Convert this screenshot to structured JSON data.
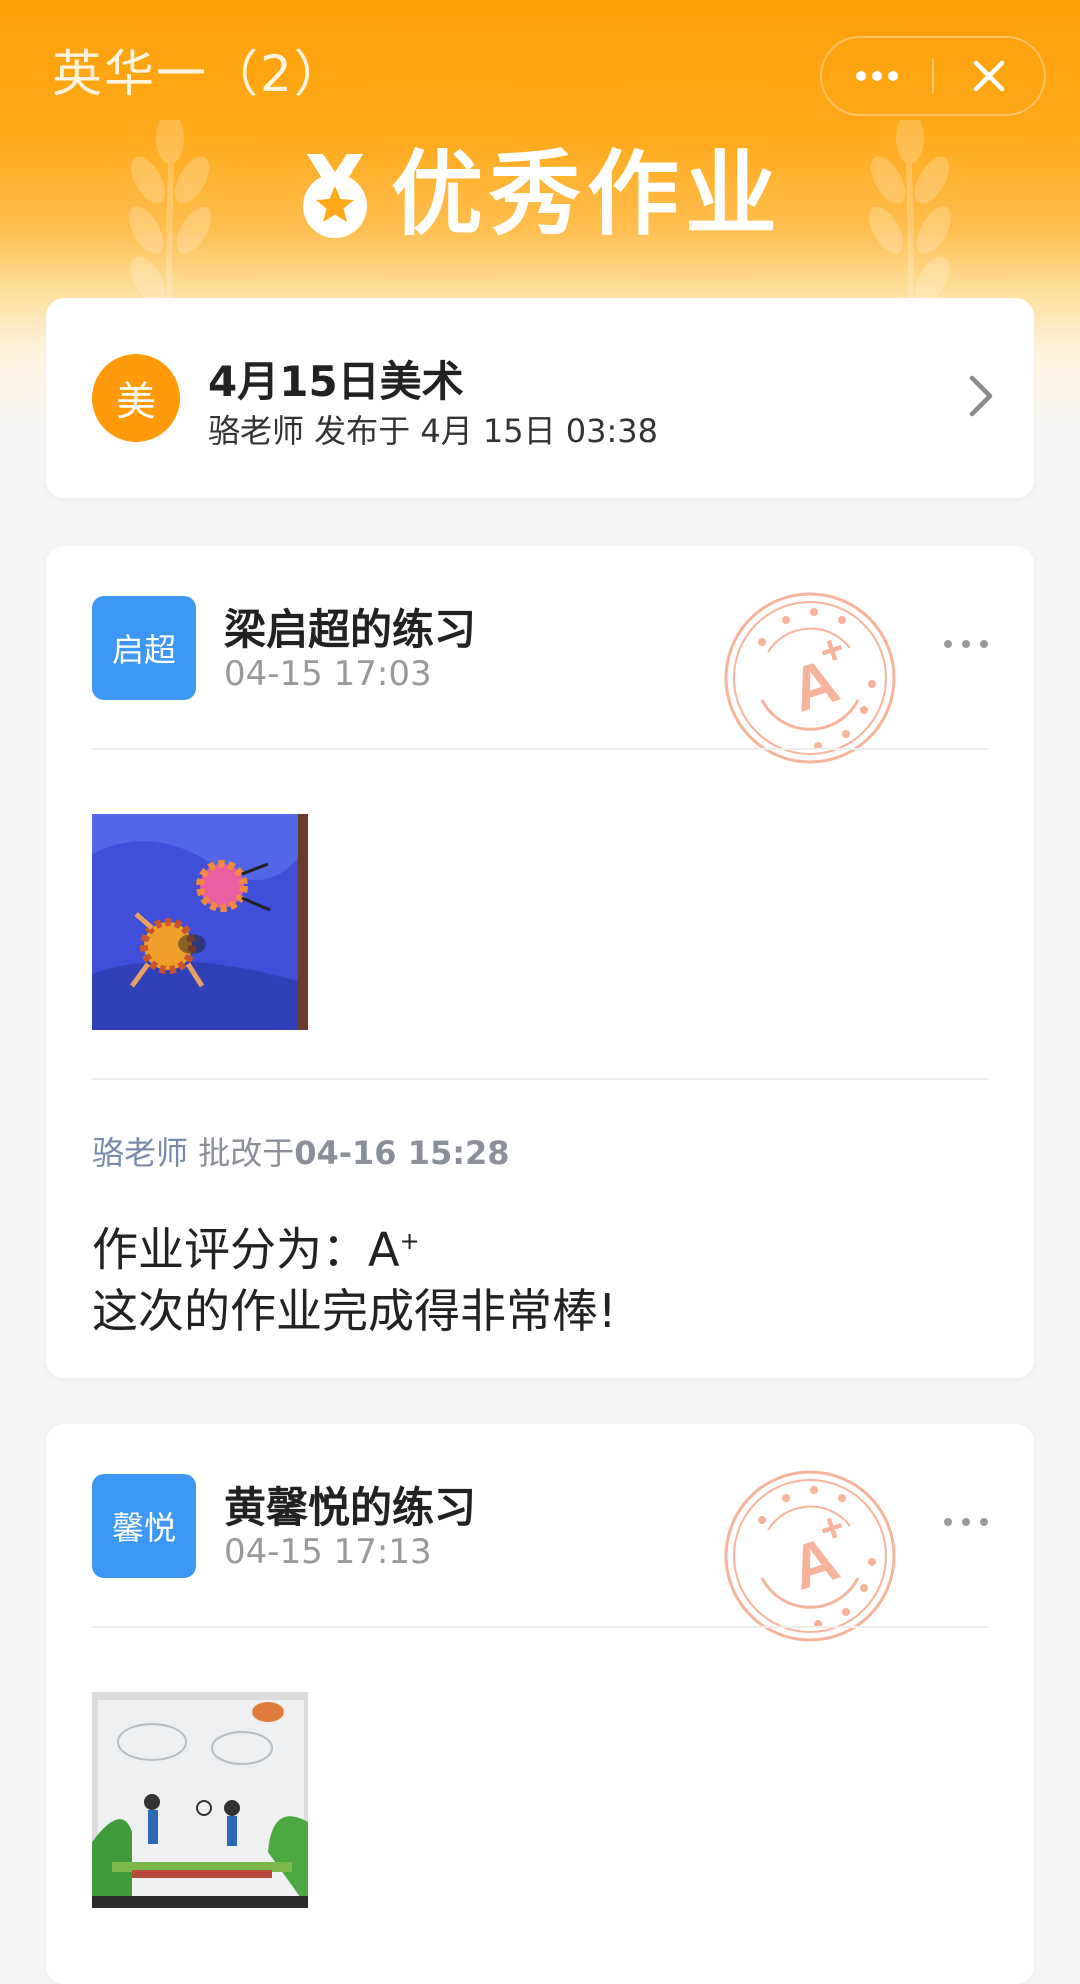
{
  "nav": {
    "title": "英华一（2）",
    "more_icon": "more-dots-icon",
    "close_icon": "close-icon"
  },
  "banner": {
    "title": "优秀作业",
    "icon": "medal-star-icon"
  },
  "assignment": {
    "badge": "美",
    "title": "4月15日美术",
    "subtitle": "骆老师 发布于 4月 15日 03:38"
  },
  "submissions": [
    {
      "avatar": "启超",
      "name": "梁启超的练习",
      "time": "04-15 17:03",
      "stamp": "A+",
      "review": {
        "teacher": "骆老师",
        "label": "批改于",
        "time": "04-16 15:28"
      },
      "score_line": "作业评分为：A",
      "score_sup": "+",
      "comment": "这次的作业完成得非常棒!"
    },
    {
      "avatar": "馨悦",
      "name": "黄馨悦的练习",
      "time": "04-15 17:13",
      "stamp": "A+"
    }
  ],
  "colors": {
    "brand": "#ffa10a",
    "avatar_blue": "#3d97f5",
    "stamp": "#f8b49a"
  }
}
